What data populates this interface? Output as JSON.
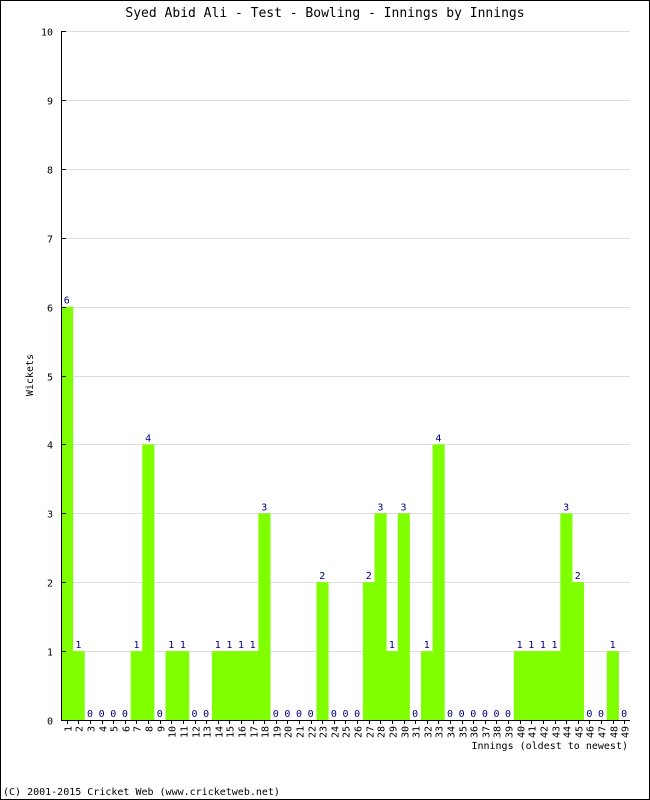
{
  "chart_data": {
    "type": "bar",
    "title": "Syed Abid Ali - Test - Bowling - Innings by Innings",
    "xlabel": "Innings (oldest to newest)",
    "ylabel": "Wickets",
    "ylim": [
      0,
      10
    ],
    "yticks": [
      0,
      1,
      2,
      3,
      4,
      5,
      6,
      7,
      8,
      9,
      10
    ],
    "grid": true,
    "bar_color": "#80ff00",
    "label_color": "#000080",
    "categories": [
      "1",
      "2",
      "3",
      "4",
      "5",
      "6",
      "7",
      "8",
      "9",
      "10",
      "11",
      "12",
      "13",
      "14",
      "15",
      "16",
      "17",
      "18",
      "19",
      "20",
      "21",
      "22",
      "23",
      "24",
      "25",
      "26",
      "27",
      "28",
      "29",
      "30",
      "31",
      "32",
      "33",
      "34",
      "35",
      "36",
      "37",
      "38",
      "39",
      "40",
      "41",
      "42",
      "43",
      "44",
      "45",
      "46",
      "47",
      "48",
      "49"
    ],
    "values": [
      6,
      1,
      0,
      0,
      0,
      0,
      1,
      4,
      0,
      1,
      1,
      0,
      0,
      1,
      1,
      1,
      1,
      3,
      0,
      0,
      0,
      0,
      2,
      0,
      0,
      0,
      2,
      3,
      1,
      3,
      0,
      1,
      4,
      0,
      0,
      0,
      0,
      0,
      0,
      1,
      1,
      1,
      1,
      3,
      2,
      0,
      0,
      1,
      0
    ]
  },
  "footer": "(C) 2001-2015 Cricket Web (www.cricketweb.net)"
}
